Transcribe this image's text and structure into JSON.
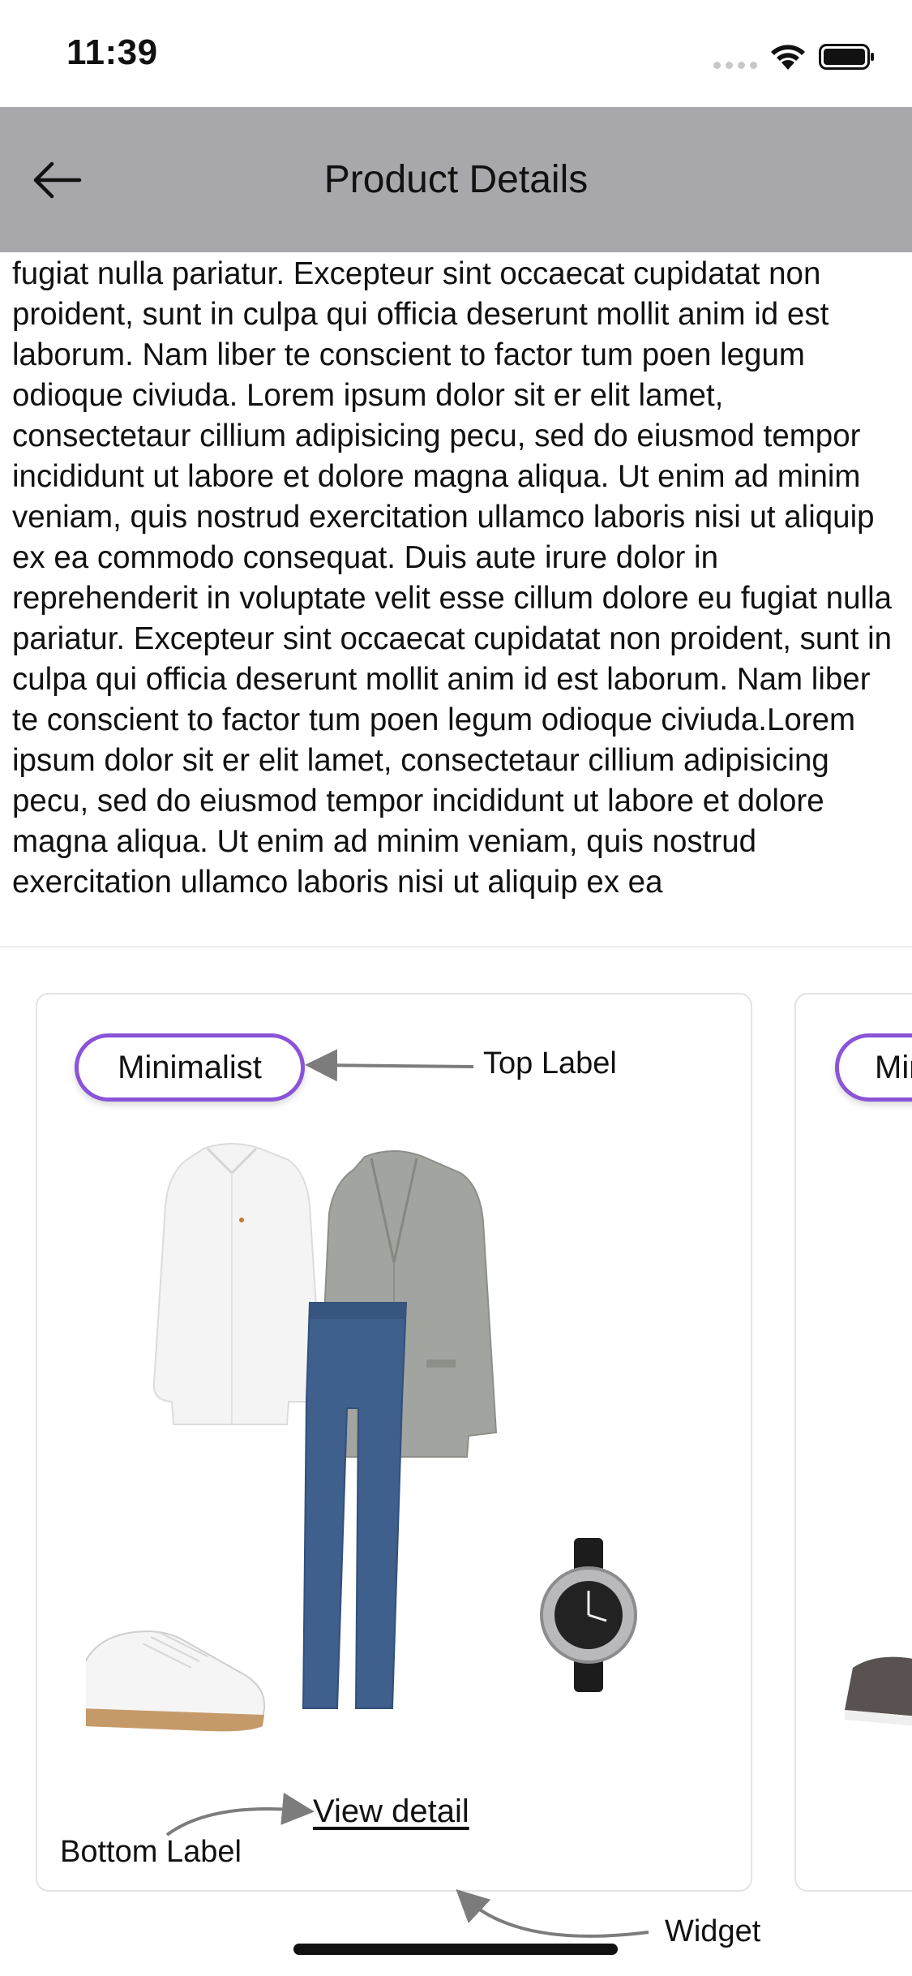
{
  "status_bar": {
    "time": "11:39"
  },
  "nav": {
    "title": "Product Details",
    "back_icon": "arrow-left-icon"
  },
  "description": {
    "text": "fugiat nulla pariatur. Excepteur sint occaecat cupidatat non proident, sunt in culpa qui officia deserunt mollit anim id est laborum. Nam liber te conscient to factor tum poen legum odioque civiuda. Lorem ipsum dolor sit er elit lamet, consectetaur cillium adipisicing pecu, sed do eiusmod tempor incididunt ut labore et dolore magna aliqua. Ut enim ad minim veniam, quis nostrud exercitation ullamco laboris nisi ut aliquip ex ea commodo consequat. Duis aute irure dolor in reprehenderit in voluptate velit esse cillum dolore eu fugiat nulla pariatur. Excepteur sint occaecat cupidatat non proident, sunt in culpa qui officia deserunt mollit anim id est laborum. Nam liber te conscient to factor tum poen legum odioque civiuda.Lorem ipsum dolor sit er elit lamet, consectetaur cillium adipisicing pecu, sed do eiusmod tempor incididunt ut labore et dolore magna aliqua. Ut enim ad minim veniam, quis nostrud exercitation ullamco laboris nisi ut aliquip ex ea"
  },
  "cards": [
    {
      "label": "Minimalist",
      "link": "View detail"
    },
    {
      "label": "Minimalist"
    }
  ],
  "annotations": {
    "top_label": "Top Label",
    "bottom_label": "Bottom Label",
    "widget": "Widget"
  },
  "colors": {
    "nav_background": "#a8a8ac",
    "pill_border": "#8a54d8",
    "pants": "#3f5f8c",
    "blazer": "#9fa19d"
  }
}
